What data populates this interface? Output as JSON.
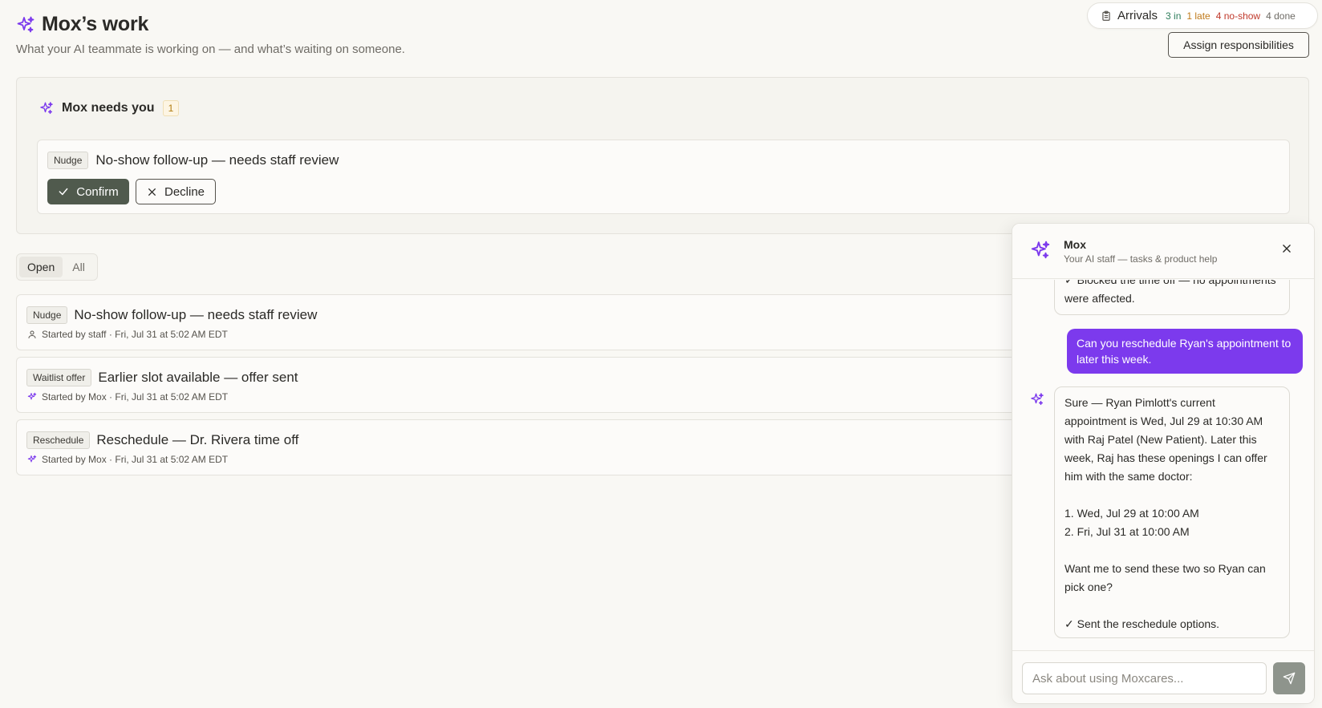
{
  "header": {
    "title": "Mox’s work",
    "subtitle": "What your AI teammate is working on — and what’s waiting on someone."
  },
  "arrivals": {
    "label": "Arrivals",
    "in": "3 in",
    "late": "1 late",
    "no_show": "4 no-show",
    "done": "4 done"
  },
  "assign_button": "Assign responsibilities",
  "needs_you": {
    "title": "Mox needs you",
    "count": "1",
    "item": {
      "tag": "Nudge",
      "title": "No-show follow-up — needs staff review"
    },
    "confirm_label": "Confirm",
    "decline_label": "Decline"
  },
  "filter_tabs": [
    "Open",
    "All"
  ],
  "tasks": [
    {
      "tag": "Nudge",
      "title": "No-show follow-up — needs staff review",
      "meta": "Started by staff · Fri, Jul 31 at 5:02 AM EDT",
      "starter_icon": "person-icon"
    },
    {
      "tag": "Waitlist offer",
      "title": "Earlier slot available — offer sent",
      "meta": "Started by Mox · Fri, Jul 31 at 5:02 AM EDT",
      "starter_icon": "sparkle-icon"
    },
    {
      "tag": "Reschedule",
      "title": "Reschedule — Dr. Rivera time off",
      "meta": "Started by Mox · Fri, Jul 31 at 5:02 AM EDT",
      "starter_icon": "sparkle-icon"
    }
  ],
  "chat": {
    "title": "Mox",
    "subtitle": "Your AI staff — tasks & product help",
    "previous_message": "✓ Blocked the time off — no appointments were affected.",
    "user_message": "Can you reschedule Ryan's appointment to later this week.",
    "reply_lines": [
      "Sure — Ryan Pimlott's current appointment is Wed, Jul 29 at 10:30 AM with Raj Patel (New Patient). Later this week, Raj has these openings I can offer him with the same doctor:",
      "",
      "1. Wed, Jul 29 at 10:00 AM",
      "2. Fri, Jul 31 at 10:00 AM",
      "",
      "Want me to send these two so Ryan can pick one?",
      "",
      "✓ Sent the reschedule options."
    ],
    "input_placeholder": "Ask about using Moxcares..."
  },
  "colors": {
    "accent": "#7c3aed",
    "confirm": "#505a4d",
    "background": "#f9f8f4"
  }
}
